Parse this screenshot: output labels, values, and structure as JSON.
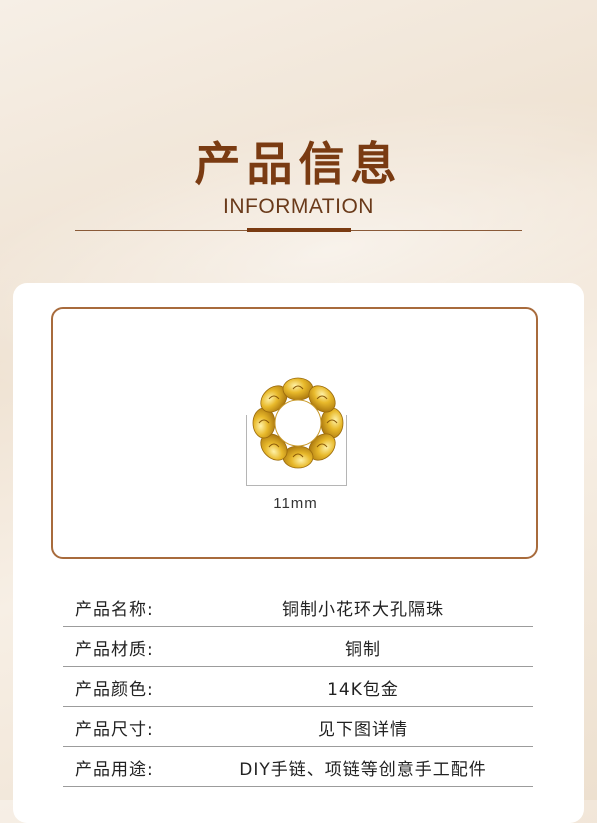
{
  "header": {
    "title": "产品信息",
    "subtitle": "INFORMATION"
  },
  "product_image": {
    "dimension_label": "11mm",
    "metal_color": "#e0b22a"
  },
  "specs": [
    {
      "label": "产品名称:",
      "value": "铜制小花环大孔隔珠"
    },
    {
      "label": "产品材质:",
      "value": "铜制"
    },
    {
      "label": "产品颜色:",
      "value": "14K包金"
    },
    {
      "label": "产品尺寸:",
      "value": "见下图详情"
    },
    {
      "label": "产品用途:",
      "value": "DIY手链、项链等创意手工配件"
    }
  ],
  "colors": {
    "title": "#7a3b12",
    "frame": "#a86b3c",
    "rule": "#8a5a38"
  }
}
